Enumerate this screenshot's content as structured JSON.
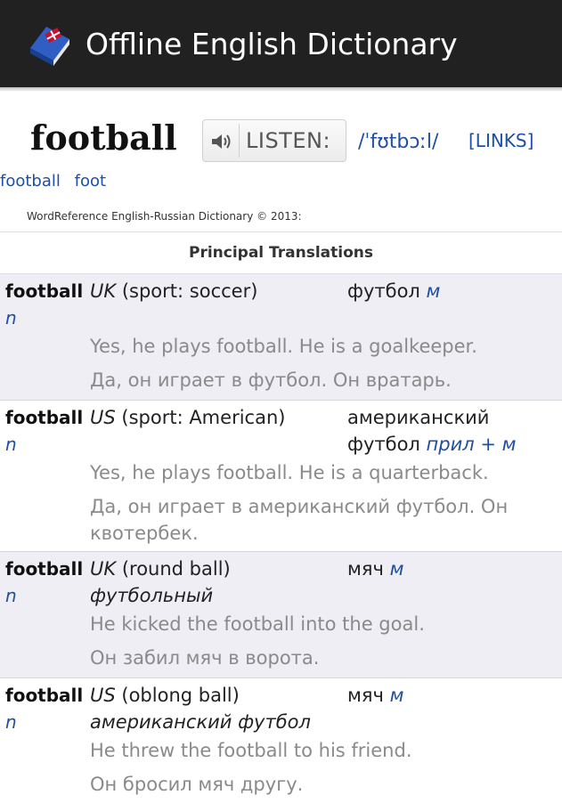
{
  "app": {
    "title": "Offline English Dictionary",
    "icon": "dictionary-book-icon"
  },
  "entry": {
    "headword": "football",
    "listen_label": "LISTEN:",
    "pronunciation": "/ˈfʊtbɔːl/",
    "links_label": "[LINKS]",
    "related": [
      "football",
      "foot"
    ],
    "copyright": "WordReference English-Russian Dictionary © 2013:"
  },
  "translations": {
    "section_title": "Principal Translations",
    "rows": [
      {
        "word": "football",
        "pos": "n",
        "region": "UK",
        "sense": "(sport: soccer)",
        "sense_extra": "",
        "translation": "футбол",
        "gender": "м",
        "example_en": "Yes, he plays football. He is a goalkeeper.",
        "example_ru": "Да, он играет в футбол. Он вратарь."
      },
      {
        "word": "football",
        "pos": "n",
        "region": "US",
        "sense": "(sport: American)",
        "sense_extra": "",
        "translation": "американский футбол",
        "gender": "прил + м",
        "example_en": "Yes, he plays football. He is a quarterback.",
        "example_ru": "Да, он играет в американский футбол. Он квотербек."
      },
      {
        "word": "football",
        "pos": "n",
        "region": "UK",
        "sense": "(round ball)",
        "sense_extra": "футбольный",
        "translation": "мяч",
        "gender": "м",
        "example_en": "He kicked the football into the goal.",
        "example_ru": "Он забил мяч в ворота."
      },
      {
        "word": "football",
        "pos": "n",
        "region": "US",
        "sense": "(oblong ball)",
        "sense_extra": "американский футбол",
        "translation": "мяч",
        "gender": "м",
        "example_en": "He threw the football to his friend.",
        "example_ru": "Он бросил мяч другу."
      }
    ]
  }
}
